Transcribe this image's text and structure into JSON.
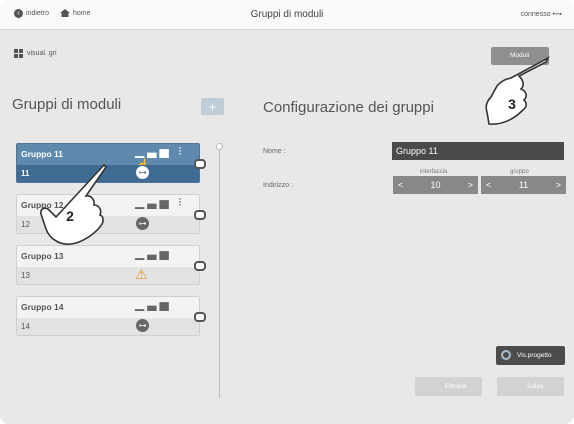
{
  "header": {
    "back_label": "indietro",
    "home_label": "home",
    "title": "Gruppi di moduli",
    "status": "connesso"
  },
  "sidebar": {
    "view_label": "visual. gri",
    "title": "Gruppi di moduli",
    "add_label": "+",
    "groups": [
      {
        "name": "Gruppo 11",
        "number": "11",
        "icons": [
          "signal-bars-icon",
          "traffic-light-icon",
          "hand-pointer-icon"
        ],
        "status_icon": "usb-icon",
        "selected": true
      },
      {
        "name": "Gruppo 12",
        "number": "12",
        "icons": [
          "signal-bars-icon",
          "traffic-light-icon"
        ],
        "status_icon": "usb-icon",
        "selected": false
      },
      {
        "name": "Gruppo 13",
        "number": "13",
        "icons": [
          "signal-bars-icon"
        ],
        "status_icon": "warning-icon",
        "selected": false
      },
      {
        "name": "Gruppo 14",
        "number": "14",
        "icons": [
          "signal-bars-icon"
        ],
        "status_icon": "usb-icon",
        "selected": false
      }
    ]
  },
  "config": {
    "title": "Configurazione dei gruppi",
    "moduli_label": "Moduli",
    "name_label": "Nome :",
    "name_value": "Gruppo 11",
    "address_label": "Indirizzo :",
    "interface_label": "interfaccia",
    "interface_value": "10",
    "group_label": "gruppo",
    "group_value": "11",
    "vis_label": "Vis.progetto",
    "delete_label": "Elimina",
    "save_label": "Salva"
  },
  "annotations": {
    "step2": "2",
    "step3": "3"
  },
  "colors": {
    "selected": "#5f8aad",
    "selected_dark": "#3f6b92",
    "warning": "#e29a28",
    "field_dark": "#4a4a4a"
  }
}
